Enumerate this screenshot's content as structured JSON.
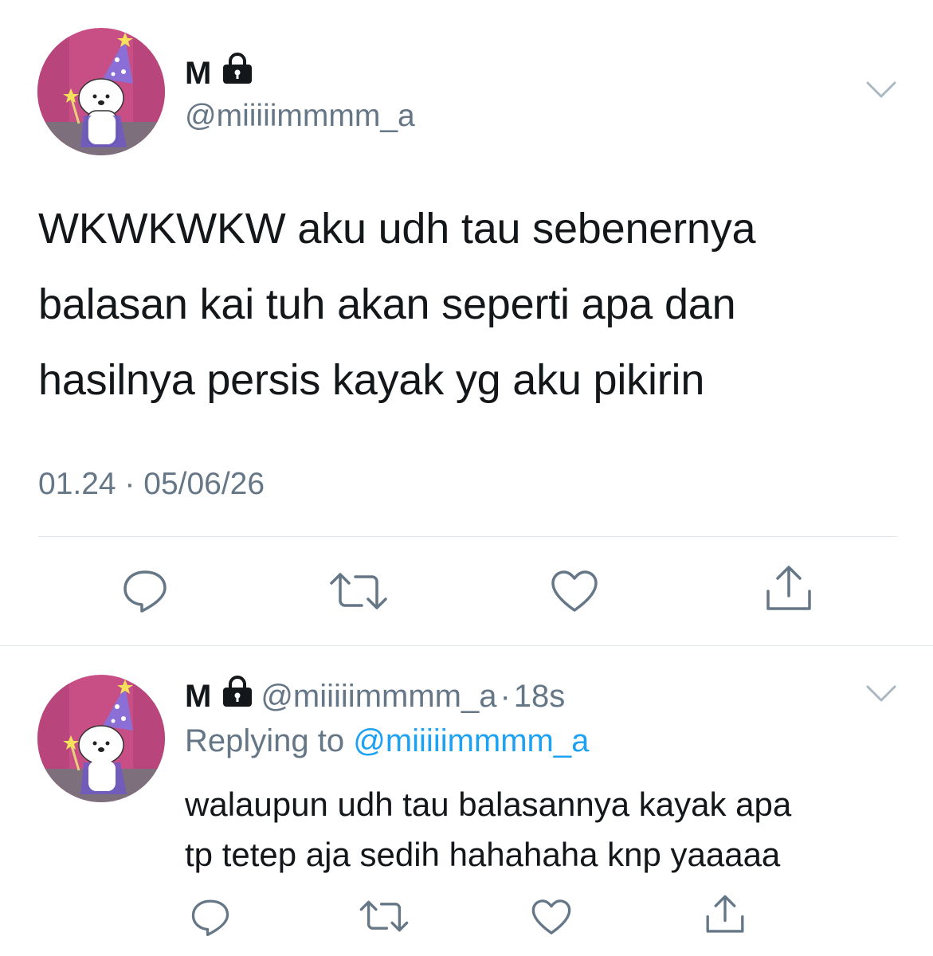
{
  "main_tweet": {
    "display_name": "M",
    "handle": "@miiiiimmmm_a",
    "text_lines": [
      "WKWKWKW aku udh tau sebenernya",
      "balasan kai tuh akan seperti apa dan",
      "hasilnya persis kayak yg aku pikirin"
    ],
    "timestamp": "01.24 · 05/06/26",
    "icons": [
      "lock-icon",
      "chevron-down-icon",
      "reply-icon",
      "retweet-icon",
      "like-icon",
      "share-icon"
    ]
  },
  "reply_tweet": {
    "display_name": "M",
    "handle": "@miiiiimmmm_a",
    "separator": "·",
    "time_ago": "18s",
    "replying_prefix": "Replying to ",
    "replying_to": "@miiiiimmmm_a",
    "text_lines": [
      "walaupun udh tau balasannya kayak apa",
      "tp tetep aja sedih hahahaha knp yaaaaa"
    ]
  },
  "colors": {
    "primary_text": "#14171a",
    "secondary_text": "#657786",
    "link": "#1da1f2",
    "divider": "#e1e8ed",
    "avatar_background": "#c84f86"
  }
}
